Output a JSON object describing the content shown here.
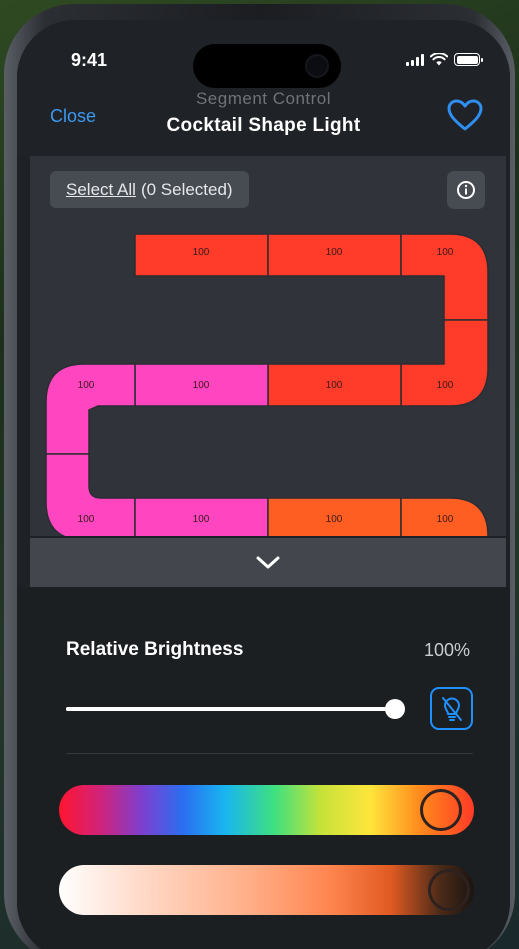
{
  "status_bar": {
    "time": "9:41"
  },
  "nav": {
    "close_label": "Close",
    "subtitle": "Segment Control",
    "title": "Cocktail Shape Light",
    "accent_color": "#3b9af0"
  },
  "selection": {
    "link_label": "Select All",
    "count_label": "(0 Selected)"
  },
  "segments": [
    {
      "value": "100",
      "color": "#ff3b2a"
    },
    {
      "value": "100",
      "color": "#ff3b2a"
    },
    {
      "value": "100",
      "color": "#ff3b2a"
    },
    {
      "value": "100",
      "color": "#ff3b2a"
    },
    {
      "value": "100",
      "color": "#ff3b2a"
    },
    {
      "value": "100",
      "color": "#ff3b2a"
    },
    {
      "value": "100",
      "color": "#ff45c0"
    },
    {
      "value": "100",
      "color": "#ff45c0"
    },
    {
      "value": "100",
      "color": "#ff45c0"
    },
    {
      "value": "100",
      "color": "#ff45c0"
    },
    {
      "value": "100",
      "color": "#ff45c0"
    },
    {
      "value": "100",
      "color": "#ff5e22"
    },
    {
      "value": "100",
      "color": "#ff5e22"
    }
  ],
  "brightness": {
    "label": "Relative Brightness",
    "value_label": "100%",
    "level": 1.0
  },
  "hue": {
    "level": 0.92
  },
  "temperature": {
    "level": 0.94
  }
}
